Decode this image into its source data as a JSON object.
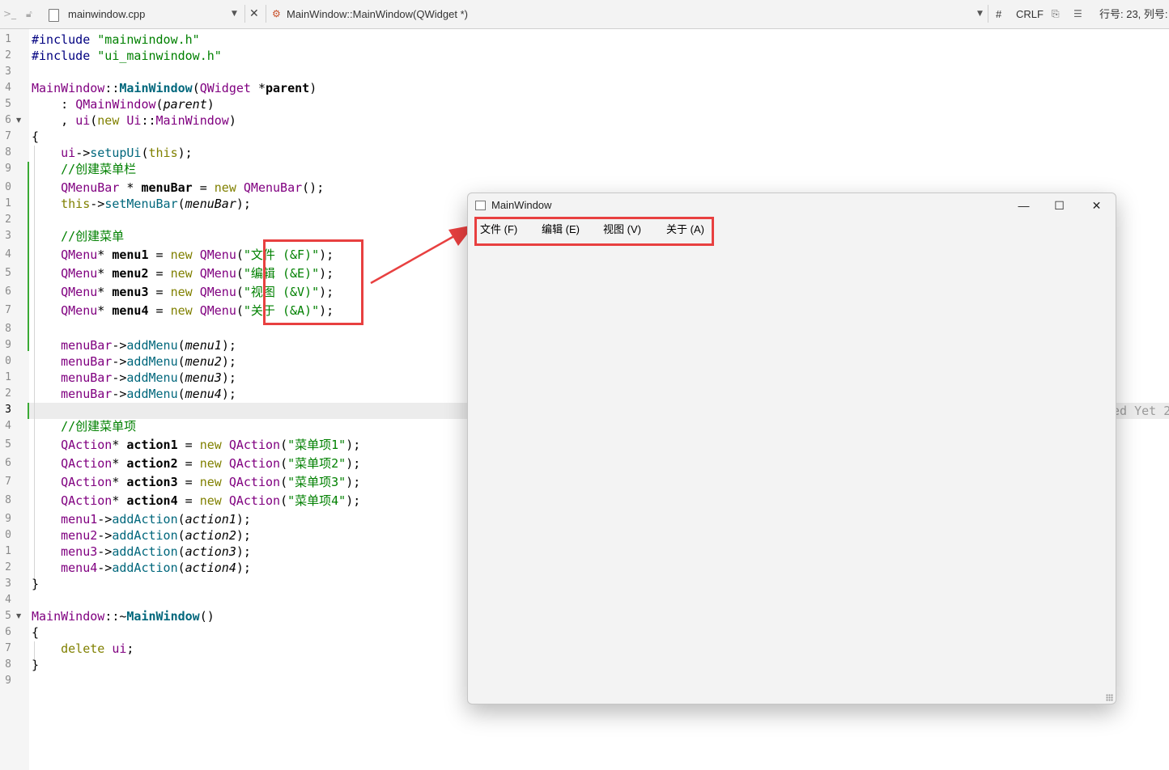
{
  "toolbar": {
    "nav_glyph": ">_",
    "file_name": "mainwindow.cpp",
    "close_glyph": "✕",
    "function_name": "MainWindow::MainWindow(QWidget *)",
    "hash_label": "#",
    "line_ending": "CRLF",
    "cursor_position": "行号: 23, 列号:"
  },
  "editor": {
    "line_numbers": [
      "1",
      "2",
      "3",
      "4",
      "5",
      "6",
      "7",
      "8",
      "9",
      "0",
      "1",
      "2",
      "3",
      "4",
      "5",
      "6",
      "7",
      "8",
      "9",
      "0",
      "1",
      "2",
      "3",
      "4",
      "5",
      "6",
      "7",
      "8",
      "9",
      "0",
      "1",
      "2",
      "3",
      "4",
      "5",
      "6",
      "7",
      "8",
      "9"
    ],
    "current_line_index": 22,
    "ghost_text": "ed Yet 2"
  },
  "main_window": {
    "title": "MainWindow",
    "minimize_glyph": "—",
    "maximize_glyph": "☐",
    "close_glyph": "✕",
    "menus": [
      {
        "label": "文件 (F)"
      },
      {
        "label": "编辑 (E)"
      },
      {
        "label": "视图 (V)"
      },
      {
        "label": "关于 (A)"
      }
    ]
  },
  "colors": {
    "annotation_red": "#e84040",
    "modified_green": "#3aaa35",
    "string_green": "#008000",
    "type_purple": "#800080",
    "keyword_olive": "#808000"
  }
}
